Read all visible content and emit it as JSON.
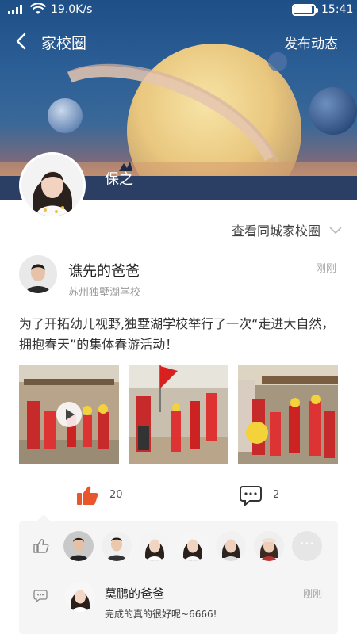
{
  "statusbar": {
    "speed": "19.0K/s",
    "time": "15:41"
  },
  "nav": {
    "title": "家校圈",
    "publish": "发布动态"
  },
  "profile": {
    "name": "保之"
  },
  "city_circle": {
    "label": "查看同城家校圈"
  },
  "post": {
    "author": "谯先的爸爸",
    "school": "苏州独墅湖学校",
    "time": "刚刚",
    "text": "为了开拓幼儿视野,独墅湖学校举行了一次“走进大自然，拥抱春天”的集体春游活动！",
    "likes": "20",
    "comments": "2"
  },
  "comment": {
    "author": "莫鹏的爸爸",
    "time": "刚刚",
    "text": "完成的真的很好呢~6666!"
  },
  "colors": {
    "accent": "#e8572c",
    "banner_top": "#1e4f86"
  },
  "icons": [
    "back-icon",
    "chevron-down-icon",
    "like-icon",
    "comment-icon",
    "play-icon",
    "more-icon"
  ]
}
